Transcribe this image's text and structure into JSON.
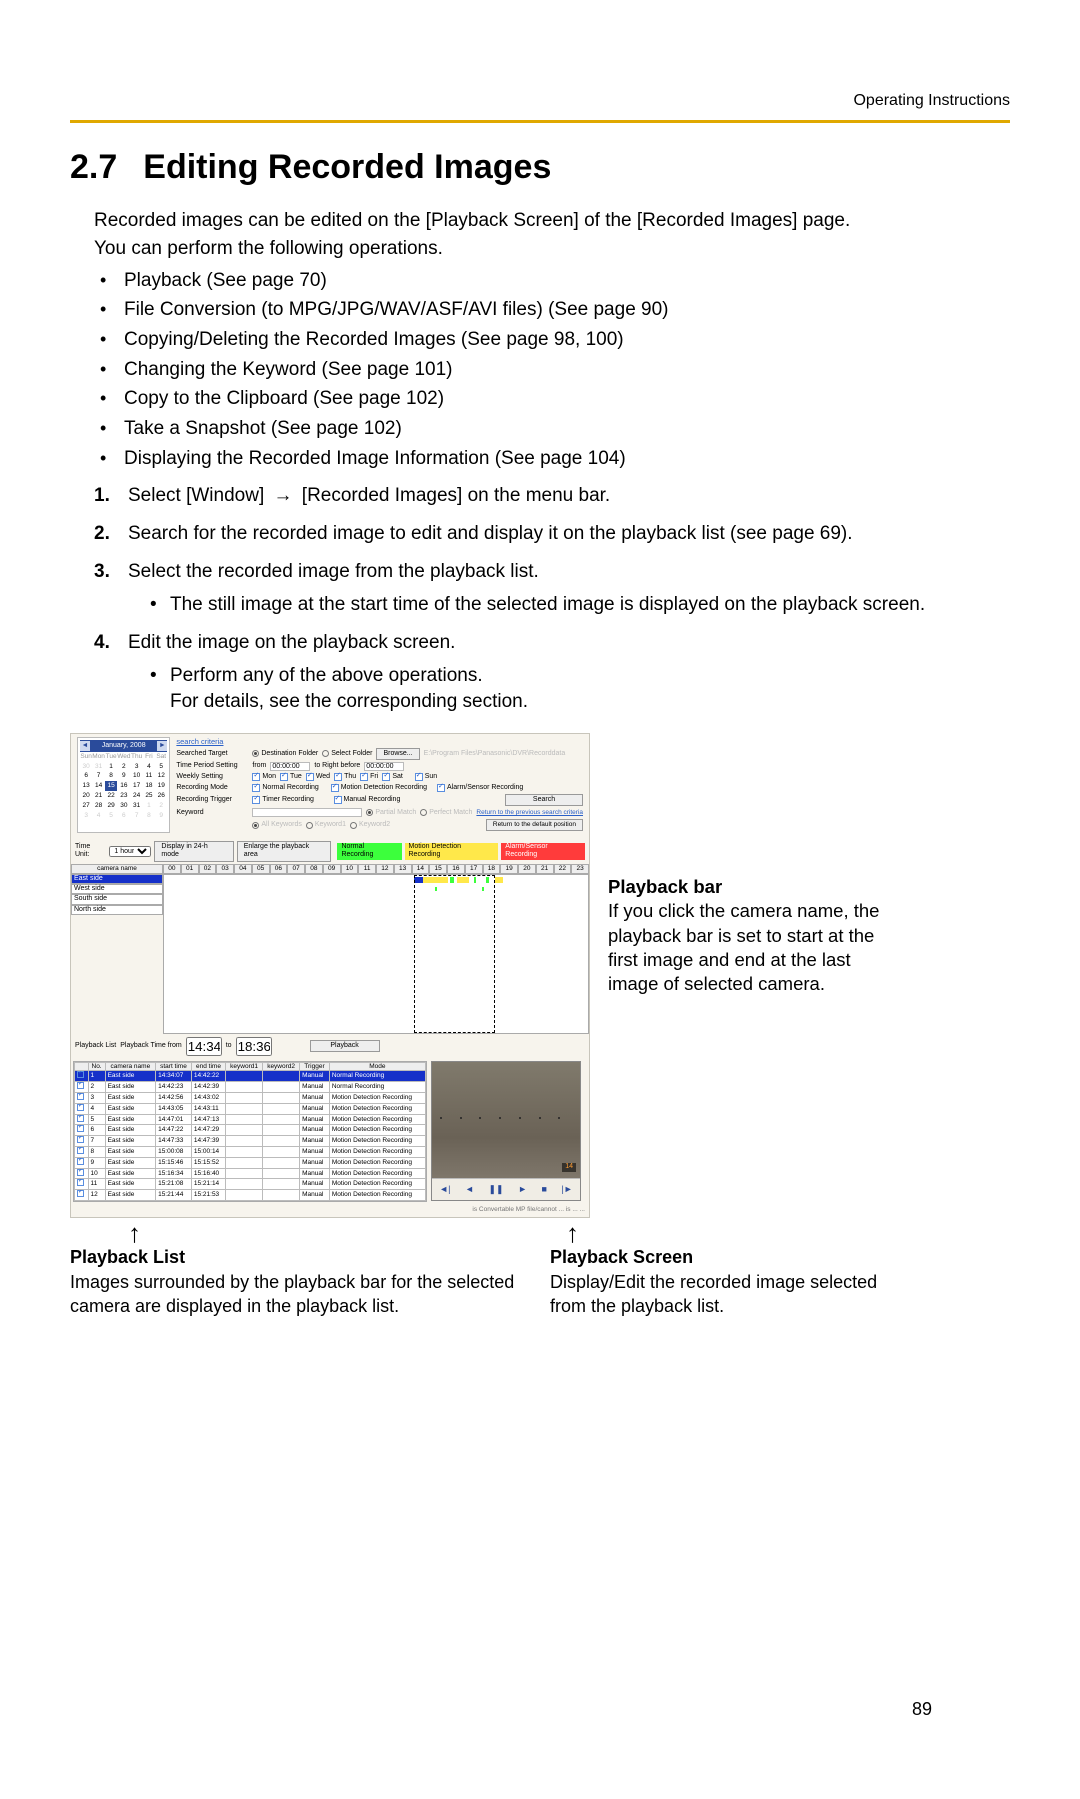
{
  "header": {
    "doc_label": "Operating Instructions"
  },
  "title": {
    "number": "2.7",
    "text": "Editing Recorded Images"
  },
  "intro": [
    "Recorded images can be edited on the [Playback Screen] of the [Recorded Images] page.",
    "You can perform the following operations."
  ],
  "bullets": [
    "Playback (See page 70)",
    "File Conversion (to MPG/JPG/WAV/ASF/AVI files) (See page 90)",
    "Copying/Deleting the Recorded Images (See page 98, 100)",
    "Changing the Keyword (See page 101)",
    "Copy to the Clipboard (See page 102)",
    "Take a Snapshot (See page 102)",
    "Displaying the Recorded Image Information (See page 104)"
  ],
  "steps": [
    {
      "n": "1.",
      "pre": "Select [Window]",
      "arrow": "→",
      "post": "[Recorded Images] on the menu bar."
    },
    {
      "n": "2.",
      "text": "Search for the recorded image to edit and display it on the playback list (see page 69)."
    },
    {
      "n": "3.",
      "text": "Select the recorded image from the playback list.",
      "sub": [
        "The still image at the start time of the selected image is displayed on the playback screen."
      ]
    },
    {
      "n": "4.",
      "text": "Edit the image on the playback screen.",
      "sub": [
        "Perform any of the above operations.\nFor details, see the corresponding section."
      ]
    }
  ],
  "shot": {
    "search_criteria": "search criteria",
    "searched_target_lbl": "Searched Target",
    "dest_folder": "Destination Folder",
    "select_folder": "Select Folder",
    "browse": "Browse...",
    "folder_path": "E:\\Program Files\\Panasonic\\DVR\\Recorddata",
    "time_period_lbl": "Time Period Setting",
    "time_from": "from",
    "t_from_val": "00:00:00",
    "to_right_before": "to Right before",
    "t_to_val": "00:00:00",
    "weekly_lbl": "Weekly Setting",
    "days": [
      "Mon",
      "Tue",
      "Wed",
      "Thu",
      "Fri",
      "Sat",
      "Sun"
    ],
    "rec_mode_lbl": "Recording Mode",
    "normal_rec": "Normal Recording",
    "motion_rec": "Motion Detection Recording",
    "alarm_rec": "Alarm/Sensor Recording",
    "rec_trigger_lbl": "Recording Trigger",
    "timer_rec": "Timer Recording",
    "manual_rec": "Manual Recording",
    "keyword_lbl": "Keyword",
    "partial_match": "Partial Match",
    "perfect_match": "Perfect Match",
    "all_keywords": "All Keywords",
    "kw1": "Keyword1",
    "kw2": "Keyword2",
    "search_btn": "Search",
    "return_prev": "Return to the previous search  criteria",
    "return_default": "Return to the default position",
    "cal_month": "January, 2008",
    "cal_days": [
      "Sun",
      "Mon",
      "Tue",
      "Wed",
      "Thu",
      "Fri",
      "Sat"
    ],
    "time_unit_lbl": "Time Unit:",
    "time_unit_val": "1 hour",
    "display24": "Display in 24-h mode",
    "enlarge": "Enlarge the playback area",
    "legend_normal": "Normal Recording",
    "legend_motion": "Motion Detection Recording",
    "legend_alarm": "Alarm/Sensor Recording",
    "camera_name_hdr": "camera name",
    "hours": [
      "00",
      "01",
      "02",
      "03",
      "04",
      "05",
      "06",
      "07",
      "08",
      "09",
      "10",
      "11",
      "12",
      "13",
      "14",
      "15",
      "16",
      "17",
      "18",
      "19",
      "20",
      "21",
      "22",
      "23"
    ],
    "cams": [
      "East side",
      "West side",
      "South side",
      "North side"
    ],
    "playback_list_lbl": "Playback List",
    "playback_time_lbl": "Playback Time  from",
    "pt_from": "14:34:07",
    "pt_to_lbl": "to",
    "pt_to": "18:36:13",
    "playback_btn": "Playback",
    "table_headers": [
      "",
      "No.",
      "camera name",
      "start time",
      "end time",
      "keyword1",
      "keyword2",
      "Trigger",
      "Mode"
    ],
    "rows": [
      [
        "1",
        "East side",
        "14:34:07",
        "14:42:22",
        "",
        "",
        "Manual",
        "Normal Recording"
      ],
      [
        "2",
        "East side",
        "14:42:23",
        "14:42:39",
        "",
        "",
        "Manual",
        "Normal Recording"
      ],
      [
        "3",
        "East side",
        "14:42:56",
        "14:43:02",
        "",
        "",
        "Manual",
        "Motion Detection Recording"
      ],
      [
        "4",
        "East side",
        "14:43:05",
        "14:43:11",
        "",
        "",
        "Manual",
        "Motion Detection Recording"
      ],
      [
        "5",
        "East side",
        "14:47:01",
        "14:47:13",
        "",
        "",
        "Manual",
        "Motion Detection Recording"
      ],
      [
        "6",
        "East side",
        "14:47:22",
        "14:47:29",
        "",
        "",
        "Manual",
        "Motion Detection Recording"
      ],
      [
        "7",
        "East side",
        "14:47:33",
        "14:47:39",
        "",
        "",
        "Manual",
        "Motion Detection Recording"
      ],
      [
        "8",
        "East side",
        "15:00:08",
        "15:00:14",
        "",
        "",
        "Manual",
        "Motion Detection Recording"
      ],
      [
        "9",
        "East side",
        "15:15:46",
        "15:15:52",
        "",
        "",
        "Manual",
        "Motion Detection Recording"
      ],
      [
        "10",
        "East side",
        "15:16:34",
        "15:16:40",
        "",
        "",
        "Manual",
        "Motion Detection Recording"
      ],
      [
        "11",
        "East side",
        "15:21:08",
        "15:21:14",
        "",
        "",
        "Manual",
        "Motion Detection Recording"
      ],
      [
        "12",
        "East side",
        "15:21:44",
        "15:21:53",
        "",
        "",
        "Manual",
        "Motion Detection Recording"
      ]
    ],
    "thumb_badge": "14",
    "thumb_footer": "is Convertable MP file/cannot ... is ... ..."
  },
  "sidenote": {
    "title": "Playback bar",
    "text": "If you click the camera name, the playback bar is set to start at the first image and end at the last image of selected camera."
  },
  "footer": {
    "left_title": "Playback List",
    "left_text": "Images surrounded by the playback bar for the selected camera are displayed in the playback list.",
    "right_title": "Playback Screen",
    "right_text": "Display/Edit the recorded image selected from the playback list.",
    "page": "89"
  }
}
